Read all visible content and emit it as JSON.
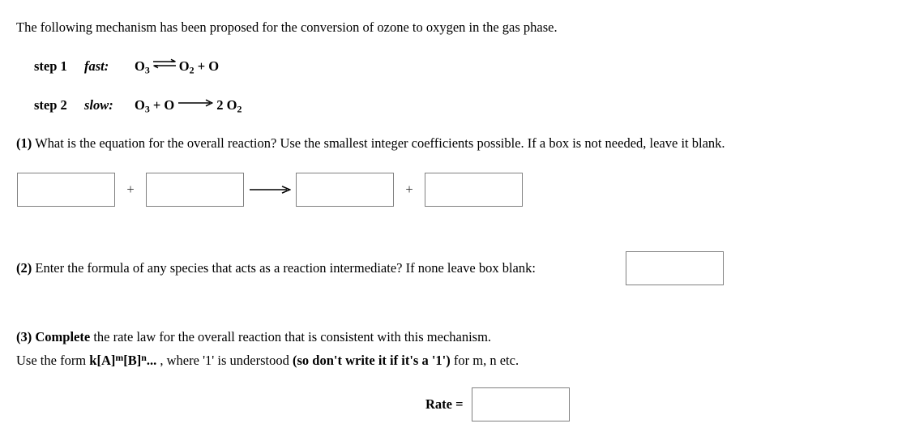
{
  "intro": {
    "text": "The following mechanism has been proposed for the conversion of ozone to oxygen in the gas phase."
  },
  "mechanism": {
    "steps": [
      {
        "label": "step 1",
        "speed": "fast:",
        "reactants": "O3",
        "arrow": "equilibrium-arrow",
        "products": "O2 + O",
        "reactant_formula": "O",
        "reactant_sub": "3",
        "product_part1": "O",
        "product_sub1": "2",
        "product_part2": "+ O"
      },
      {
        "label": "step 2",
        "speed": "slow:",
        "arrow": "reaction-arrow",
        "reactant_formula": "O",
        "reactant_sub": "3",
        "reactant_part2": "+ O",
        "product_coeff": "2 O",
        "product_sub": "2"
      }
    ]
  },
  "questions": {
    "q1": {
      "number": "(1)",
      "text": " What is the equation for the overall reaction? Use the smallest integer coefficients possible. If a box is not needed, leave it blank.",
      "boxes": [
        {
          "name": "reactant-1",
          "value": "",
          "placeholder": ""
        },
        {
          "name": "reactant-2",
          "value": "",
          "placeholder": ""
        },
        {
          "name": "product-1",
          "value": "",
          "placeholder": ""
        },
        {
          "name": "product-2",
          "value": "",
          "placeholder": ""
        }
      ],
      "separators": {
        "plus": "+",
        "arrow": "reaction-arrow"
      }
    },
    "q2": {
      "number": "(2)",
      "text": "  Enter the formula of any species that acts as a reaction intermediate? If none leave box blank:",
      "box": {
        "value": "",
        "placeholder": ""
      }
    },
    "q3": {
      "number": "(3) ",
      "bold_lead": "Complete",
      "line1_rest": " the rate law for the overall reaction that is consistent with this mechanism.",
      "line2_prefix": "Use the form ",
      "formula_k": "k[A]",
      "formula_sup_m": "m",
      "formula_b": "[B]",
      "formula_sup_n": "n",
      "formula_ellipsis": "... ",
      "line2_mid": ", where '1' is understood ",
      "line2_bold": "(so don't write it if it's a '1')",
      "line2_end": " for m, n etc.",
      "rate_label": "Rate =",
      "box": {
        "value": "",
        "placeholder": ""
      }
    }
  },
  "colors": {
    "box_border": "#808080",
    "text": "#000000",
    "background": "#ffffff"
  }
}
